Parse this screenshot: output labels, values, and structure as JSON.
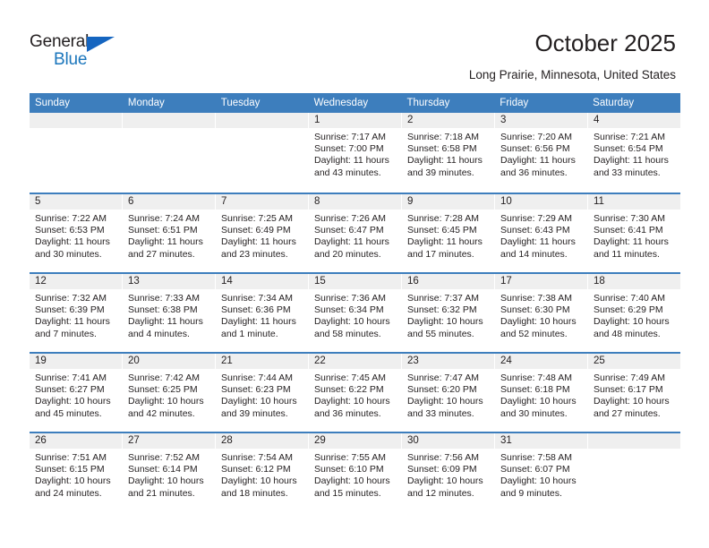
{
  "brand": {
    "name_top": "General",
    "name_bottom": "Blue",
    "triangle_icon": "triangle-icon",
    "color_black": "#231f20",
    "color_blue": "#1b76bc"
  },
  "header": {
    "title": "October 2025",
    "subtitle": "Long Prairie, Minnesota, United States"
  },
  "theme": {
    "header_blue": "#3d7ebd",
    "cell_head_gray": "#efefef",
    "text": "#231f20"
  },
  "weekdays": [
    "Sunday",
    "Monday",
    "Tuesday",
    "Wednesday",
    "Thursday",
    "Friday",
    "Saturday"
  ],
  "labels": {
    "sunrise": "Sunrise:",
    "sunset": "Sunset:",
    "daylight": "Daylight:"
  },
  "weeks": [
    [
      {
        "day": "",
        "empty": true
      },
      {
        "day": "",
        "empty": true
      },
      {
        "day": "",
        "empty": true
      },
      {
        "day": "1",
        "sunrise": "Sunrise: 7:17 AM",
        "sunset": "Sunset: 7:00 PM",
        "daylight_1": "Daylight: 11 hours",
        "daylight_2": "and 43 minutes."
      },
      {
        "day": "2",
        "sunrise": "Sunrise: 7:18 AM",
        "sunset": "Sunset: 6:58 PM",
        "daylight_1": "Daylight: 11 hours",
        "daylight_2": "and 39 minutes."
      },
      {
        "day": "3",
        "sunrise": "Sunrise: 7:20 AM",
        "sunset": "Sunset: 6:56 PM",
        "daylight_1": "Daylight: 11 hours",
        "daylight_2": "and 36 minutes."
      },
      {
        "day": "4",
        "sunrise": "Sunrise: 7:21 AM",
        "sunset": "Sunset: 6:54 PM",
        "daylight_1": "Daylight: 11 hours",
        "daylight_2": "and 33 minutes."
      }
    ],
    [
      {
        "day": "5",
        "sunrise": "Sunrise: 7:22 AM",
        "sunset": "Sunset: 6:53 PM",
        "daylight_1": "Daylight: 11 hours",
        "daylight_2": "and 30 minutes."
      },
      {
        "day": "6",
        "sunrise": "Sunrise: 7:24 AM",
        "sunset": "Sunset: 6:51 PM",
        "daylight_1": "Daylight: 11 hours",
        "daylight_2": "and 27 minutes."
      },
      {
        "day": "7",
        "sunrise": "Sunrise: 7:25 AM",
        "sunset": "Sunset: 6:49 PM",
        "daylight_1": "Daylight: 11 hours",
        "daylight_2": "and 23 minutes."
      },
      {
        "day": "8",
        "sunrise": "Sunrise: 7:26 AM",
        "sunset": "Sunset: 6:47 PM",
        "daylight_1": "Daylight: 11 hours",
        "daylight_2": "and 20 minutes."
      },
      {
        "day": "9",
        "sunrise": "Sunrise: 7:28 AM",
        "sunset": "Sunset: 6:45 PM",
        "daylight_1": "Daylight: 11 hours",
        "daylight_2": "and 17 minutes."
      },
      {
        "day": "10",
        "sunrise": "Sunrise: 7:29 AM",
        "sunset": "Sunset: 6:43 PM",
        "daylight_1": "Daylight: 11 hours",
        "daylight_2": "and 14 minutes."
      },
      {
        "day": "11",
        "sunrise": "Sunrise: 7:30 AM",
        "sunset": "Sunset: 6:41 PM",
        "daylight_1": "Daylight: 11 hours",
        "daylight_2": "and 11 minutes."
      }
    ],
    [
      {
        "day": "12",
        "sunrise": "Sunrise: 7:32 AM",
        "sunset": "Sunset: 6:39 PM",
        "daylight_1": "Daylight: 11 hours",
        "daylight_2": "and 7 minutes."
      },
      {
        "day": "13",
        "sunrise": "Sunrise: 7:33 AM",
        "sunset": "Sunset: 6:38 PM",
        "daylight_1": "Daylight: 11 hours",
        "daylight_2": "and 4 minutes."
      },
      {
        "day": "14",
        "sunrise": "Sunrise: 7:34 AM",
        "sunset": "Sunset: 6:36 PM",
        "daylight_1": "Daylight: 11 hours",
        "daylight_2": "and 1 minute."
      },
      {
        "day": "15",
        "sunrise": "Sunrise: 7:36 AM",
        "sunset": "Sunset: 6:34 PM",
        "daylight_1": "Daylight: 10 hours",
        "daylight_2": "and 58 minutes."
      },
      {
        "day": "16",
        "sunrise": "Sunrise: 7:37 AM",
        "sunset": "Sunset: 6:32 PM",
        "daylight_1": "Daylight: 10 hours",
        "daylight_2": "and 55 minutes."
      },
      {
        "day": "17",
        "sunrise": "Sunrise: 7:38 AM",
        "sunset": "Sunset: 6:30 PM",
        "daylight_1": "Daylight: 10 hours",
        "daylight_2": "and 52 minutes."
      },
      {
        "day": "18",
        "sunrise": "Sunrise: 7:40 AM",
        "sunset": "Sunset: 6:29 PM",
        "daylight_1": "Daylight: 10 hours",
        "daylight_2": "and 48 minutes."
      }
    ],
    [
      {
        "day": "19",
        "sunrise": "Sunrise: 7:41 AM",
        "sunset": "Sunset: 6:27 PM",
        "daylight_1": "Daylight: 10 hours",
        "daylight_2": "and 45 minutes."
      },
      {
        "day": "20",
        "sunrise": "Sunrise: 7:42 AM",
        "sunset": "Sunset: 6:25 PM",
        "daylight_1": "Daylight: 10 hours",
        "daylight_2": "and 42 minutes."
      },
      {
        "day": "21",
        "sunrise": "Sunrise: 7:44 AM",
        "sunset": "Sunset: 6:23 PM",
        "daylight_1": "Daylight: 10 hours",
        "daylight_2": "and 39 minutes."
      },
      {
        "day": "22",
        "sunrise": "Sunrise: 7:45 AM",
        "sunset": "Sunset: 6:22 PM",
        "daylight_1": "Daylight: 10 hours",
        "daylight_2": "and 36 minutes."
      },
      {
        "day": "23",
        "sunrise": "Sunrise: 7:47 AM",
        "sunset": "Sunset: 6:20 PM",
        "daylight_1": "Daylight: 10 hours",
        "daylight_2": "and 33 minutes."
      },
      {
        "day": "24",
        "sunrise": "Sunrise: 7:48 AM",
        "sunset": "Sunset: 6:18 PM",
        "daylight_1": "Daylight: 10 hours",
        "daylight_2": "and 30 minutes."
      },
      {
        "day": "25",
        "sunrise": "Sunrise: 7:49 AM",
        "sunset": "Sunset: 6:17 PM",
        "daylight_1": "Daylight: 10 hours",
        "daylight_2": "and 27 minutes."
      }
    ],
    [
      {
        "day": "26",
        "sunrise": "Sunrise: 7:51 AM",
        "sunset": "Sunset: 6:15 PM",
        "daylight_1": "Daylight: 10 hours",
        "daylight_2": "and 24 minutes."
      },
      {
        "day": "27",
        "sunrise": "Sunrise: 7:52 AM",
        "sunset": "Sunset: 6:14 PM",
        "daylight_1": "Daylight: 10 hours",
        "daylight_2": "and 21 minutes."
      },
      {
        "day": "28",
        "sunrise": "Sunrise: 7:54 AM",
        "sunset": "Sunset: 6:12 PM",
        "daylight_1": "Daylight: 10 hours",
        "daylight_2": "and 18 minutes."
      },
      {
        "day": "29",
        "sunrise": "Sunrise: 7:55 AM",
        "sunset": "Sunset: 6:10 PM",
        "daylight_1": "Daylight: 10 hours",
        "daylight_2": "and 15 minutes."
      },
      {
        "day": "30",
        "sunrise": "Sunrise: 7:56 AM",
        "sunset": "Sunset: 6:09 PM",
        "daylight_1": "Daylight: 10 hours",
        "daylight_2": "and 12 minutes."
      },
      {
        "day": "31",
        "sunrise": "Sunrise: 7:58 AM",
        "sunset": "Sunset: 6:07 PM",
        "daylight_1": "Daylight: 10 hours",
        "daylight_2": "and 9 minutes."
      },
      {
        "day": "",
        "empty": true
      }
    ]
  ]
}
